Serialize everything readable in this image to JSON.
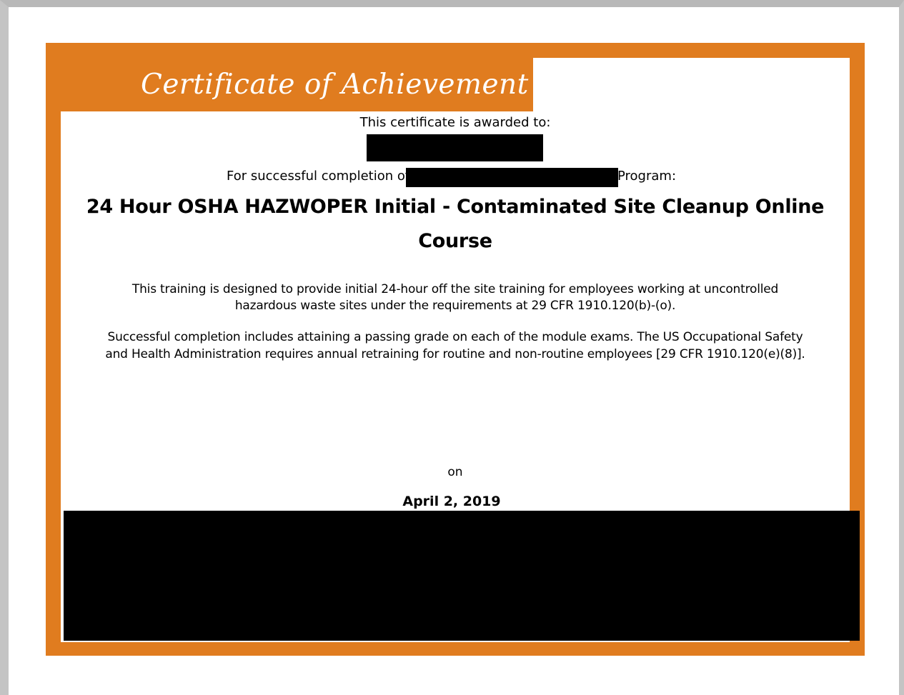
{
  "certificate": {
    "header_title": "Certificate of Achievement",
    "awarded_to_label": "This certificate is awarded to:",
    "completion_prefix": "For successful completion of",
    "program_suffix": "Program:",
    "course_title": "24 Hour OSHA HAZWOPER Initial - Contaminated Site Cleanup Online Course",
    "description": "This training is designed to provide initial 24-hour off the site training for employees working at uncontrolled hazardous waste sites under the requirements at 29 CFR 1910.120(b)-(o).",
    "completion_note": "Successful completion includes attaining a passing grade on each of the module exams. The US Occupational Safety and Health Administration requires annual retraining for routine and non-routine employees [29 CFR 1910.120(e)(8)].",
    "on_label": "on",
    "date": "April 2, 2019"
  },
  "colors": {
    "border": "#e07c1f",
    "background": "#ffffff",
    "redaction": "#000000"
  }
}
